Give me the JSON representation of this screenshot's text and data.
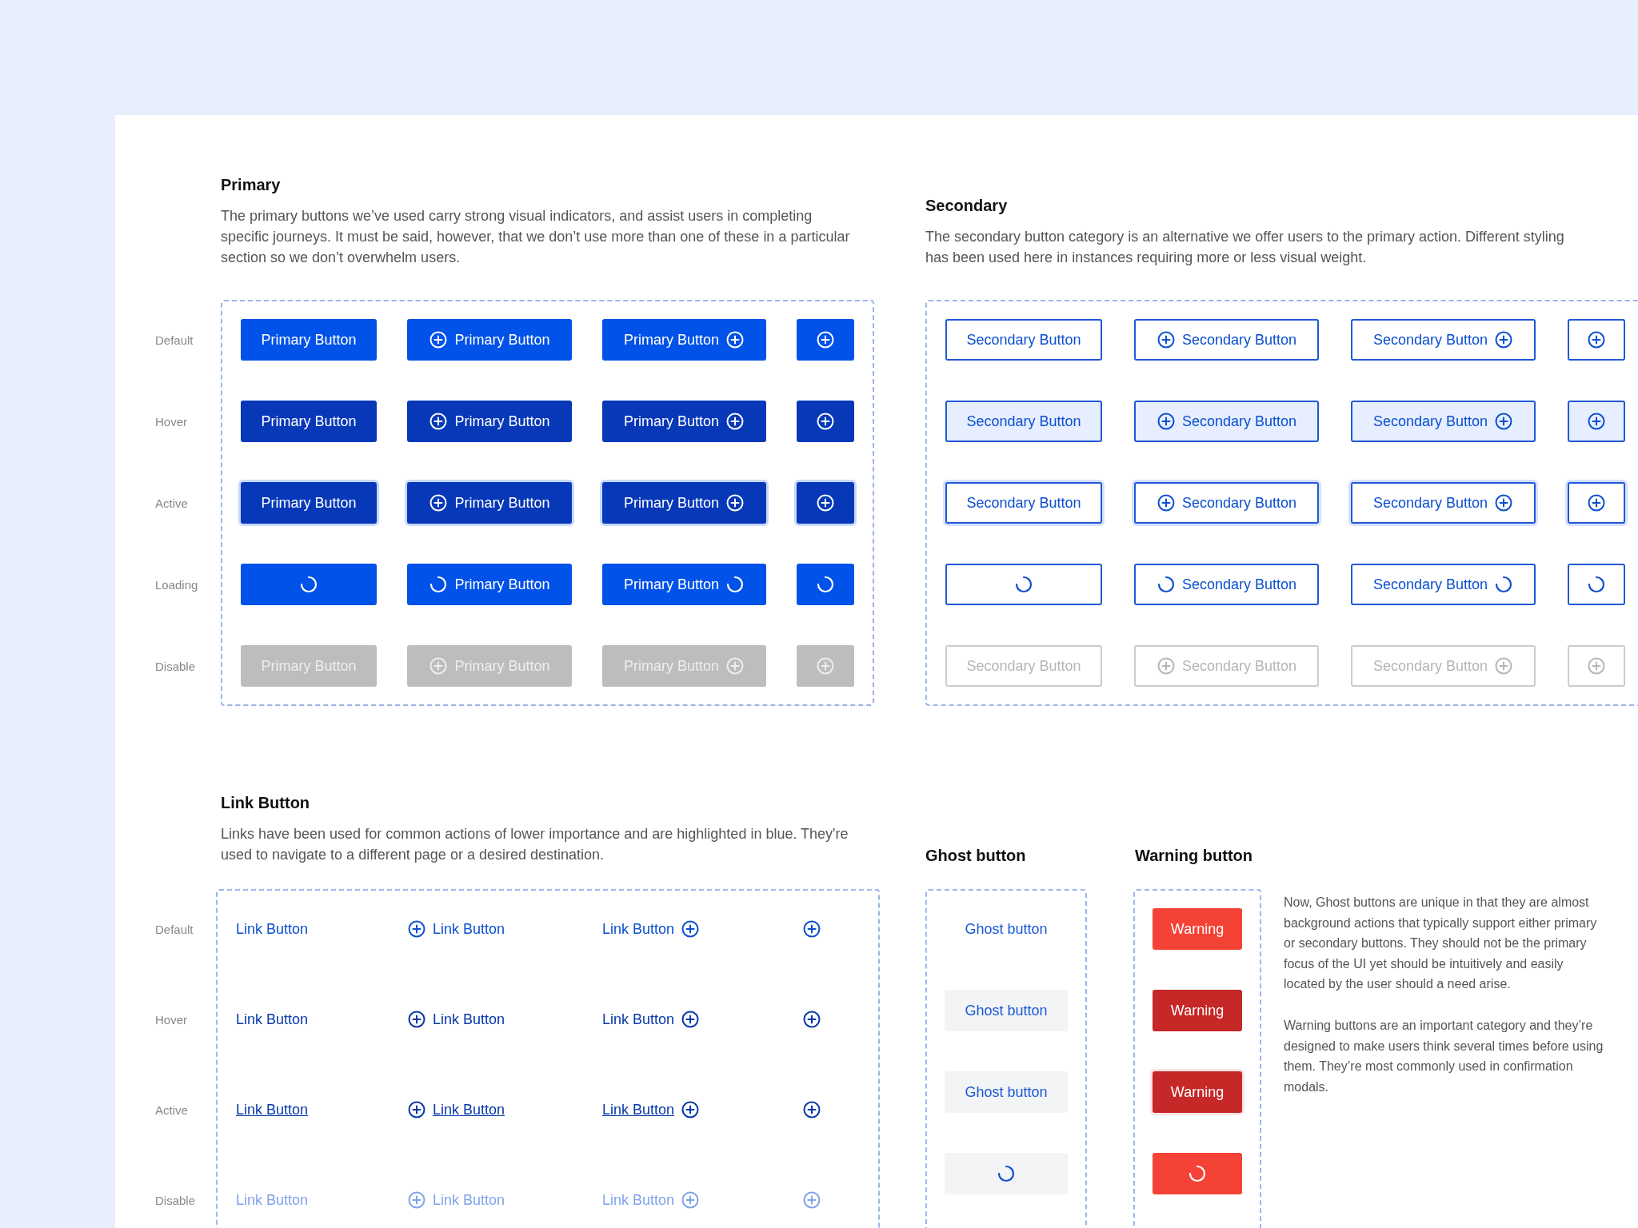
{
  "sections": [
    {
      "kind": "primary",
      "title": "Primary",
      "description": "The primary buttons we’ve used carry strong visual indicators, and assist users in completing specific journeys. It must be said, however, that we don’t use more than one of these in a particular section so we don’t overwhelm users.",
      "rows": [
        {
          "label": "Default",
          "kind": "default",
          "buttons": [
            {
              "kind": "text",
              "label": "Primary Button"
            },
            {
              "kind": "left",
              "label": "Primary Button"
            },
            {
              "kind": "right",
              "label": "Primary Button"
            },
            {
              "kind": "icon"
            }
          ]
        },
        {
          "label": "Hover",
          "kind": "hover",
          "buttons": [
            {
              "kind": "text",
              "label": "Primary Button"
            },
            {
              "kind": "left",
              "label": "Primary Button"
            },
            {
              "kind": "right",
              "label": "Primary Button"
            },
            {
              "kind": "icon"
            }
          ]
        },
        {
          "label": "Active",
          "kind": "active",
          "buttons": [
            {
              "kind": "text",
              "label": "Primary Button"
            },
            {
              "kind": "left",
              "label": "Primary Button"
            },
            {
              "kind": "right",
              "label": "Primary Button"
            },
            {
              "kind": "icon"
            }
          ]
        },
        {
          "label": "Loading",
          "kind": "loading",
          "buttons": [
            {
              "kind": "icon"
            },
            {
              "kind": "left",
              "label": "Primary Button"
            },
            {
              "kind": "right",
              "label": "Primary Button"
            },
            {
              "kind": "icon"
            }
          ]
        },
        {
          "label": "Disable",
          "kind": "disabled",
          "buttons": [
            {
              "kind": "text",
              "label": "Primary Button"
            },
            {
              "kind": "left",
              "label": "Primary Button"
            },
            {
              "kind": "right",
              "label": "Primary Button"
            },
            {
              "kind": "icon"
            }
          ]
        }
      ]
    },
    {
      "kind": "secondary",
      "title": "Secondary",
      "description": "The secondary button category is an alternative we offer users to the primary action. Different styling has been used here in instances requiring more or less visual weight.",
      "rows": [
        {
          "kind": "default",
          "buttons": [
            {
              "kind": "text",
              "label": "Secondary Button"
            },
            {
              "kind": "left",
              "label": "Secondary Button"
            },
            {
              "kind": "right",
              "label": "Secondary Button"
            },
            {
              "kind": "icon"
            }
          ]
        },
        {
          "kind": "hover",
          "buttons": [
            {
              "kind": "text",
              "label": "Secondary Button"
            },
            {
              "kind": "left",
              "label": "Secondary Button"
            },
            {
              "kind": "right",
              "label": "Secondary Button"
            },
            {
              "kind": "icon"
            }
          ]
        },
        {
          "kind": "active",
          "buttons": [
            {
              "kind": "text",
              "label": "Secondary Button"
            },
            {
              "kind": "left",
              "label": "Secondary Button"
            },
            {
              "kind": "right",
              "label": "Secondary Button"
            },
            {
              "kind": "icon"
            }
          ]
        },
        {
          "kind": "loading",
          "buttons": [
            {
              "kind": "icon"
            },
            {
              "kind": "left",
              "label": "Secondary Button"
            },
            {
              "kind": "right",
              "label": "Secondary Button"
            },
            {
              "kind": "icon"
            }
          ]
        },
        {
          "kind": "disabled",
          "buttons": [
            {
              "kind": "text",
              "label": "Secondary Button"
            },
            {
              "kind": "left",
              "label": "Secondary Button"
            },
            {
              "kind": "right",
              "label": "Secondary Button"
            },
            {
              "kind": "icon"
            }
          ]
        }
      ]
    },
    {
      "kind": "link",
      "title": "Link Button",
      "description": "Links have been used for common actions of lower importance and are highlighted in blue. They're used to navigate to a different page or a desired destination.",
      "rows": [
        {
          "label": "Default",
          "kind": "default",
          "buttons": [
            {
              "kind": "text",
              "label": "Link Button"
            },
            {
              "kind": "left",
              "label": "Link Button"
            },
            {
              "kind": "right",
              "label": "Link Button"
            },
            {
              "kind": "icon"
            }
          ]
        },
        {
          "label": "Hover",
          "kind": "hover",
          "buttons": [
            {
              "kind": "text",
              "label": "Link Button"
            },
            {
              "kind": "left",
              "label": "Link Button"
            },
            {
              "kind": "right",
              "label": "Link Button"
            },
            {
              "kind": "icon"
            }
          ]
        },
        {
          "label": "Active",
          "kind": "active",
          "buttons": [
            {
              "kind": "text",
              "label": "Link Button"
            },
            {
              "kind": "left",
              "label": "Link Button"
            },
            {
              "kind": "right",
              "label": "Link Button"
            },
            {
              "kind": "icon"
            }
          ]
        },
        {
          "label": "Disable",
          "kind": "disabled",
          "buttons": [
            {
              "kind": "text",
              "label": "Link Button"
            },
            {
              "kind": "left",
              "label": "Link Button"
            },
            {
              "kind": "right",
              "label": "Link Button"
            },
            {
              "kind": "icon"
            }
          ]
        }
      ]
    }
  ],
  "narrow_sections": [
    {
      "kind": "ghost",
      "title": "Ghost button",
      "buttons": [
        {
          "kind": "default",
          "label": "Ghost button"
        },
        {
          "kind": "hover",
          "label": "Ghost button"
        },
        {
          "kind": "active",
          "label": "Ghost button"
        },
        {
          "kind": "loading"
        }
      ]
    },
    {
      "kind": "warning",
      "title": "Warning button",
      "buttons": [
        {
          "kind": "default",
          "label": "Warning"
        },
        {
          "kind": "hover",
          "label": "Warning"
        },
        {
          "kind": "active",
          "label": "Warning"
        },
        {
          "kind": "loading"
        }
      ]
    }
  ],
  "notes": [
    "Now, Ghost buttons are unique in that they are almost background actions that typically support either primary or secondary buttons. They should not be the primary focus of the UI yet should be intuitively and easily located by the user should a need arise.",
    "Warning buttons are an important category and they’re designed to make users think several times before using them. They’re most commonly used in confirmation modals."
  ]
}
